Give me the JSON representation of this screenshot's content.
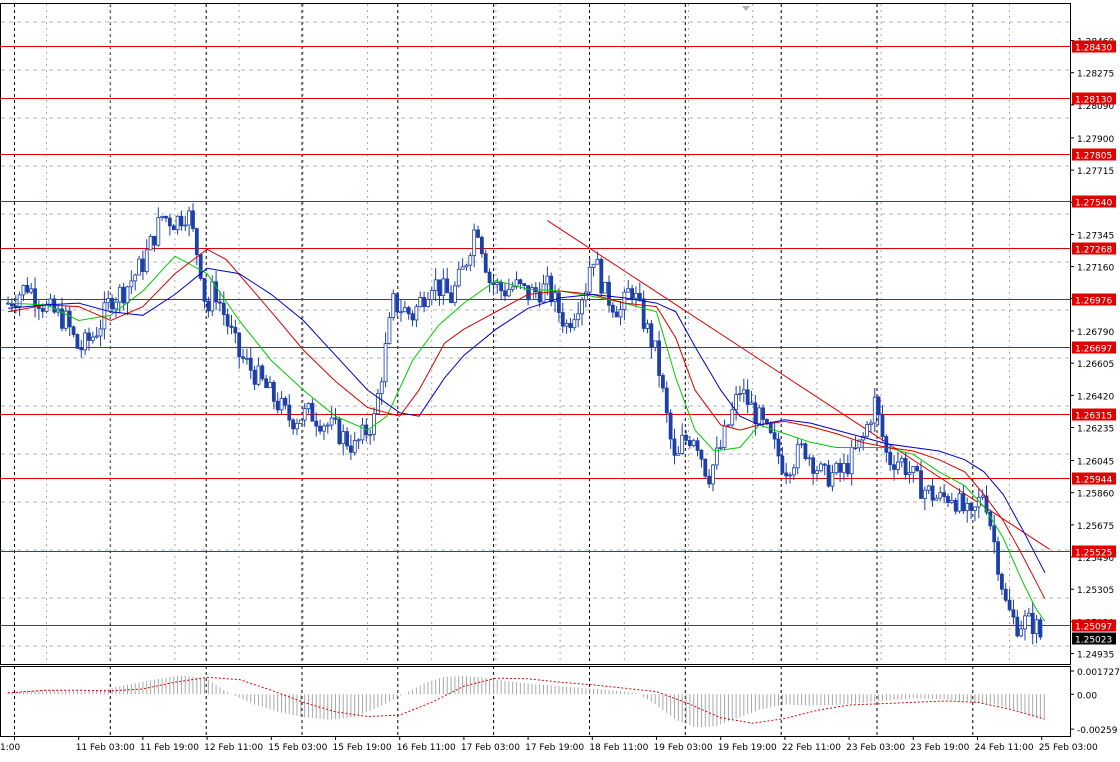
{
  "chart_data": [
    {
      "type": "candlestick",
      "title": "",
      "xlabel": "",
      "ylabel": "",
      "x_tick_labels": [
        "1:00",
        "11 Feb 03:00",
        "11 Feb 19:00",
        "12 Feb 11:00",
        "15 Feb 03:00",
        "15 Feb 19:00",
        "16 Feb 11:00",
        "17 Feb 03:00",
        "17 Feb 19:00",
        "18 Feb 11:00",
        "19 Feb 03:00",
        "19 Feb 19:00",
        "22 Feb 11:00",
        "23 Feb 03:00",
        "23 Feb 19:00",
        "24 Feb 11:00",
        "25 Feb 03:00"
      ],
      "y_tick_labels": [
        "1.28460",
        "1.28275",
        "1.28090",
        "1.27900",
        "1.27715",
        "1.27530",
        "1.27345",
        "1.27160",
        "1.26976",
        "1.26790",
        "1.26605",
        "1.26420",
        "1.26235",
        "1.26045",
        "1.25860",
        "1.25675",
        "1.25490",
        "1.25305",
        "1.25120",
        "1.24935"
      ],
      "ylim": [
        1.24875,
        1.2867
      ],
      "grid": true,
      "horizontal_levels": [
        1.2843,
        1.2813,
        1.27805,
        1.2754,
        1.27268,
        1.26976,
        1.26697,
        1.26315,
        1.25944,
        1.25525,
        1.25097
      ],
      "current_price": 1.25023,
      "trendline": {
        "start": [
          8.3,
          1.27425
        ],
        "end": [
          16.12,
          1.25535
        ]
      },
      "series": [
        {
          "name": "",
          "role": "price_close",
          "x": [
            -0.1,
            0.2,
            0.5,
            0.8,
            1.0,
            1.2,
            1.35,
            1.5,
            1.7,
            2.0,
            2.3,
            2.5,
            2.7,
            2.9,
            3.0,
            3.1,
            3.3,
            3.5,
            3.8,
            4.0,
            4.3,
            4.6,
            5.0,
            5.3,
            5.6,
            5.9,
            6.2,
            6.5,
            6.8,
            7.0,
            7.2,
            7.4,
            7.6,
            7.8,
            8.0,
            8.3,
            8.6,
            8.9,
            9.0,
            9.2,
            9.45,
            9.6,
            9.8,
            10.0,
            10.2,
            10.3,
            10.4,
            10.6,
            10.8,
            11.0,
            11.3,
            11.6,
            11.8,
            12.0,
            12.3,
            12.6,
            12.9,
            13.2,
            13.4,
            13.6,
            13.8,
            14.1,
            14.4,
            14.6,
            14.9,
            15.1,
            15.3,
            15.45,
            15.6,
            15.75,
            15.9,
            16.0
          ],
          "y": [
            1.2695,
            1.2705,
            1.2692,
            1.2685,
            1.2668,
            1.2675,
            1.2684,
            1.2698,
            1.2702,
            1.2718,
            1.2745,
            1.2742,
            1.2748,
            1.2715,
            1.2688,
            1.2705,
            1.2685,
            1.2665,
            1.2652,
            1.2642,
            1.2628,
            1.2632,
            1.2622,
            1.2612,
            1.2628,
            1.2695,
            1.2688,
            1.2708,
            1.2698,
            1.2715,
            1.2742,
            1.2708,
            1.2702,
            1.2705,
            1.27,
            1.2704,
            1.2682,
            1.2705,
            1.2725,
            1.27,
            1.269,
            1.2705,
            1.2685,
            1.2665,
            1.262,
            1.26,
            1.2615,
            1.262,
            1.2595,
            1.2612,
            1.2645,
            1.2628,
            1.2615,
            1.26,
            1.2612,
            1.2595,
            1.2598,
            1.2615,
            1.2638,
            1.2605,
            1.2605,
            1.259,
            1.2582,
            1.2585,
            1.257,
            1.2588,
            1.255,
            1.252,
            1.251,
            1.2512,
            1.251,
            1.2502
          ]
        },
        {
          "name": "",
          "role": "moving_average",
          "color": "#00cc00",
          "x": [
            -0.1,
            0.5,
            1.0,
            1.5,
            2.0,
            2.5,
            3.0,
            3.5,
            4.0,
            4.5,
            5.0,
            5.5,
            5.8,
            6.2,
            6.6,
            7.0,
            7.5,
            8.0,
            8.5,
            9.0,
            9.5,
            10.0,
            10.3,
            10.6,
            10.9,
            11.3,
            11.6,
            12.0,
            12.4,
            12.8,
            13.2,
            13.6,
            14.0,
            14.4,
            14.8,
            15.1,
            15.4,
            15.7,
            15.9,
            16.05
          ],
          "y": [
            1.2695,
            1.2694,
            1.2685,
            1.2688,
            1.2702,
            1.2722,
            1.2712,
            1.2685,
            1.2662,
            1.2645,
            1.263,
            1.2622,
            1.263,
            1.2662,
            1.2682,
            1.2695,
            1.2708,
            1.2703,
            1.2702,
            1.2699,
            1.2695,
            1.269,
            1.2652,
            1.2622,
            1.261,
            1.2612,
            1.2625,
            1.262,
            1.2615,
            1.2612,
            1.2612,
            1.2612,
            1.2608,
            1.2598,
            1.259,
            1.2578,
            1.256,
            1.2535,
            1.252,
            1.2512
          ]
        },
        {
          "name": "",
          "role": "moving_average",
          "color": "#dd0000",
          "x": [
            -0.1,
            0.5,
            1.0,
            1.5,
            2.0,
            2.5,
            3.0,
            3.3,
            4.0,
            4.5,
            5.0,
            5.5,
            6.0,
            6.3,
            6.7,
            7.0,
            7.5,
            8.0,
            8.5,
            9.0,
            9.5,
            10.0,
            10.3,
            10.6,
            11.0,
            11.3,
            11.6,
            12.0,
            12.4,
            12.8,
            13.2,
            13.6,
            14.0,
            14.4,
            14.8,
            15.1,
            15.4,
            15.7,
            16.05
          ],
          "y": [
            1.269,
            1.2694,
            1.2693,
            1.2685,
            1.2693,
            1.2712,
            1.2726,
            1.272,
            1.269,
            1.2668,
            1.265,
            1.2635,
            1.263,
            1.2645,
            1.2672,
            1.268,
            1.269,
            1.27,
            1.2702,
            1.27,
            1.2695,
            1.2693,
            1.2675,
            1.2645,
            1.2625,
            1.2622,
            1.2625,
            1.2627,
            1.2624,
            1.262,
            1.2615,
            1.2612,
            1.261,
            1.2605,
            1.2598,
            1.2585,
            1.257,
            1.255,
            1.2525
          ]
        },
        {
          "name": "",
          "role": "moving_average",
          "color": "#0000cc",
          "x": [
            -0.1,
            0.5,
            1.0,
            1.5,
            2.0,
            2.5,
            3.0,
            3.5,
            4.0,
            4.5,
            5.0,
            5.5,
            6.0,
            6.3,
            6.7,
            7.0,
            7.5,
            8.0,
            8.5,
            9.0,
            9.5,
            10.0,
            10.3,
            10.6,
            11.0,
            11.3,
            11.6,
            12.0,
            12.4,
            12.8,
            13.2,
            13.6,
            14.0,
            14.4,
            14.8,
            15.1,
            15.4,
            15.7,
            16.05
          ],
          "y": [
            1.2692,
            1.2694,
            1.2695,
            1.269,
            1.2688,
            1.27,
            1.2715,
            1.2712,
            1.27,
            1.2685,
            1.2665,
            1.2645,
            1.2632,
            1.263,
            1.2652,
            1.2665,
            1.268,
            1.2692,
            1.2698,
            1.27,
            1.2698,
            1.2695,
            1.269,
            1.267,
            1.2645,
            1.263,
            1.2625,
            1.2628,
            1.2626,
            1.2622,
            1.2618,
            1.2614,
            1.2612,
            1.261,
            1.2605,
            1.2598,
            1.2585,
            1.2565,
            1.254
          ]
        }
      ]
    },
    {
      "type": "bar",
      "title": "",
      "y_tick_labels": [
        "0.001727",
        "0.00",
        "-0.00259"
      ],
      "ylim": [
        -0.0031,
        0.0021
      ],
      "series": [
        {
          "name": "",
          "role": "histogram",
          "x": [
            -0.1,
            0.3,
            0.6,
            1.0,
            1.4,
            1.8,
            2.2,
            2.6,
            3.0,
            3.3,
            3.7,
            4.1,
            4.5,
            4.9,
            5.3,
            5.7,
            6.1,
            6.4,
            6.7,
            7.0,
            7.3,
            7.7,
            8.1,
            8.5,
            8.9,
            9.3,
            9.7,
            10.0,
            10.3,
            10.6,
            10.9,
            11.2,
            11.6,
            12.0,
            12.4,
            12.8,
            13.2,
            13.6,
            14.0,
            14.4,
            14.8,
            15.2,
            15.5,
            15.8,
            16.05
          ],
          "y": [
            0.00015,
            0.0003,
            0.00035,
            0.0002,
            0.00035,
            0.00075,
            0.0011,
            0.0014,
            0.00115,
            0.0002,
            -0.0007,
            -0.0013,
            -0.0017,
            -0.0019,
            -0.0017,
            -0.0009,
            0.0001,
            0.00085,
            0.0013,
            0.00135,
            0.00125,
            0.00095,
            0.00075,
            0.0006,
            0.00045,
            0.0003,
            0.0001,
            -0.0008,
            -0.0019,
            -0.00245,
            -0.0024,
            -0.0019,
            -0.00115,
            -0.00075,
            -0.00085,
            -0.0008,
            -0.00065,
            -0.00045,
            -0.0003,
            -0.00035,
            -0.0005,
            -0.0007,
            -0.001,
            -0.0015,
            -0.0018
          ]
        },
        {
          "name": "",
          "role": "signal_line",
          "color": "#dd0000",
          "x": [
            -0.1,
            0.5,
            1.0,
            1.5,
            2.0,
            2.5,
            3.0,
            3.5,
            4.0,
            4.5,
            5.0,
            5.5,
            6.0,
            6.5,
            7.0,
            7.5,
            8.0,
            8.5,
            9.0,
            9.5,
            10.0,
            10.5,
            11.0,
            11.5,
            12.0,
            12.5,
            13.0,
            13.5,
            14.0,
            14.5,
            15.0,
            15.5,
            16.05
          ],
          "y": [
            0.0001,
            0.0003,
            0.0003,
            0.00025,
            0.0004,
            0.0009,
            0.00125,
            0.0011,
            0.0003,
            -0.0006,
            -0.0013,
            -0.00165,
            -0.00155,
            -0.0006,
            0.0006,
            0.0012,
            0.00115,
            0.0009,
            0.0007,
            0.00045,
            0.0002,
            -0.0007,
            -0.00175,
            -0.00215,
            -0.0018,
            -0.0012,
            -0.0008,
            -0.0007,
            -0.0006,
            -0.0005,
            -0.0006,
            -0.0011,
            -0.00185
          ]
        }
      ]
    }
  ]
}
